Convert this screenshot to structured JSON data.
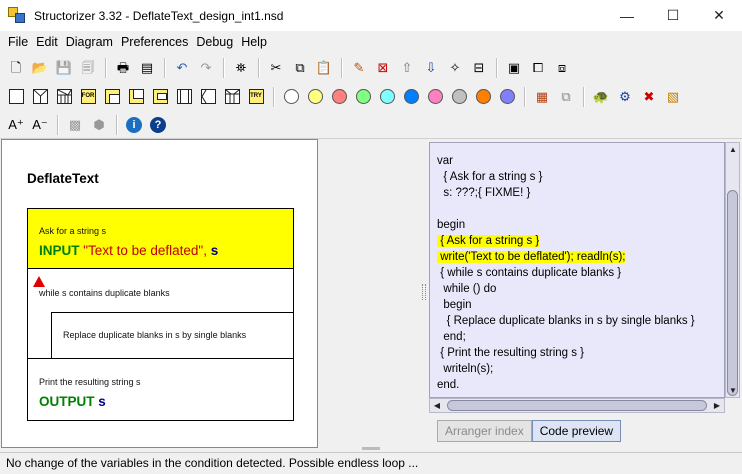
{
  "window": {
    "title": "Structorizer 3.32 - DeflateText_design_int1.nsd",
    "minimize_glyph": "—",
    "maximize_glyph": "☐",
    "close_glyph": "✕"
  },
  "menu": [
    {
      "name": "menu-file",
      "label": "File"
    },
    {
      "name": "menu-edit",
      "label": "Edit"
    },
    {
      "name": "menu-diagram",
      "label": "Diagram"
    },
    {
      "name": "menu-preferences",
      "label": "Preferences"
    },
    {
      "name": "menu-debug",
      "label": "Debug"
    },
    {
      "name": "menu-help",
      "label": "Help"
    }
  ],
  "palette_colors": [
    "#ffffff",
    "#ffff80",
    "#ff8080",
    "#80ff80",
    "#80ffff",
    "#0080ff",
    "#ff80c0",
    "#c0c0c0",
    "#ff8000",
    "#8080ff"
  ],
  "diagram": {
    "title": "DeflateText",
    "input_comment": "Ask for a string s",
    "input_keyword": "INPUT",
    "input_string": "\"Text to be deflated\"",
    "input_sep": ",",
    "input_var": "s",
    "while_comment": "while s contains duplicate blanks",
    "body_comment": "Replace duplicate blanks in s by single blanks",
    "output_comment": "Print the resulting string s",
    "output_keyword": "OUTPUT",
    "output_var": "s"
  },
  "code": [
    {
      "text": "var",
      "hl": false
    },
    {
      "text": "  { Ask for a string s }",
      "hl": false
    },
    {
      "text": "  s: ???;{ FIXME! }",
      "hl": false
    },
    {
      "text": "",
      "hl": false
    },
    {
      "text": "begin",
      "hl": false
    },
    {
      "text": " { Ask for a string s }",
      "hl": true
    },
    {
      "text": " write('Text to be deflated'); readln(s);",
      "hl": true
    },
    {
      "text": " { while s contains duplicate blanks }",
      "hl": false
    },
    {
      "text": "  while () do",
      "hl": false
    },
    {
      "text": "  begin",
      "hl": false
    },
    {
      "text": "   { Replace duplicate blanks in s by single blanks }",
      "hl": false
    },
    {
      "text": "  end;",
      "hl": false
    },
    {
      "text": " { Print the resulting string s }",
      "hl": false
    },
    {
      "text": "  writeln(s);",
      "hl": false
    },
    {
      "text": "end.",
      "hl": false
    }
  ],
  "tabs": {
    "arranger": "Arranger index",
    "preview": "Code preview"
  },
  "status": "No change of the variables in the condition detected. Possible endless loop ..."
}
